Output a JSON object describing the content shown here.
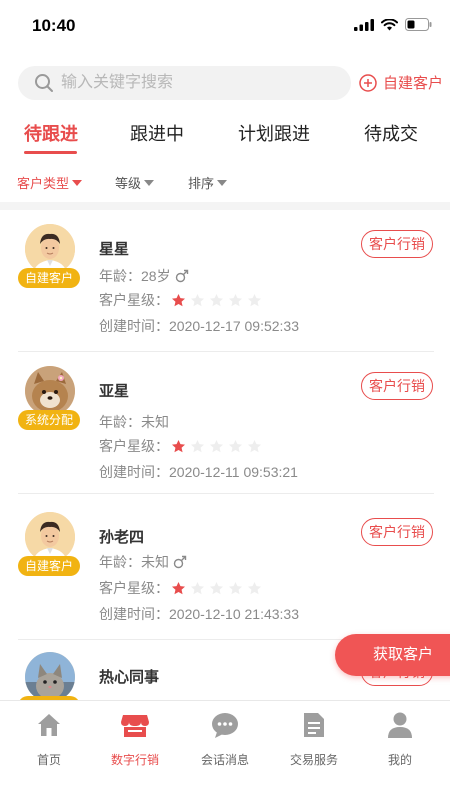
{
  "status_bar": {
    "time": "10:40"
  },
  "search": {
    "placeholder": "输入关键字搜索",
    "add_label": "自建客户"
  },
  "tabs": [
    {
      "label": "待跟进",
      "active": true
    },
    {
      "label": "跟进中",
      "active": false
    },
    {
      "label": "计划跟进",
      "active": false
    },
    {
      "label": "待成交",
      "active": false
    }
  ],
  "filters": [
    {
      "label": "客户类型",
      "active": true
    },
    {
      "label": "等级",
      "active": false
    },
    {
      "label": "排序",
      "active": false
    }
  ],
  "customers": [
    {
      "name": "星星",
      "age_label": "年龄：",
      "age": "28岁",
      "gender_icon": "male-icon",
      "rating_label": "客户星级：",
      "stars": 1,
      "max_stars": 5,
      "created_label": "创建时间：",
      "created": "2020-12-17 09:52:33",
      "badge": "自建客户",
      "avatar": "man-avatar",
      "action": "客户行销"
    },
    {
      "name": "亚星",
      "age_label": "年龄：",
      "age": "未知",
      "gender_icon": "",
      "rating_label": "客户星级：",
      "stars": 1,
      "max_stars": 5,
      "created_label": "创建时间：",
      "created": "2020-12-11 09:53:21",
      "badge": "系统分配",
      "avatar": "dog-avatar",
      "action": "客户行销"
    },
    {
      "name": "孙老四",
      "age_label": "年龄：",
      "age": "未知",
      "gender_icon": "male-icon",
      "rating_label": "客户星级：",
      "stars": 1,
      "max_stars": 5,
      "created_label": "创建时间：",
      "created": "2020-12-10 21:43:33",
      "badge": "自建客户",
      "avatar": "man-avatar",
      "action": "客户行销"
    },
    {
      "name": "热心同事",
      "age_label": "年龄：",
      "age": "",
      "gender_icon": "",
      "rating_label": "",
      "stars": 0,
      "max_stars": 5,
      "created_label": "",
      "created": "",
      "badge": "",
      "avatar": "cat-avatar",
      "action": "客户行销"
    }
  ],
  "fab": {
    "label": "获取客户"
  },
  "bottom_nav": [
    {
      "label": "首页",
      "icon": "home-icon",
      "active": false
    },
    {
      "label": "数字行销",
      "icon": "store-icon",
      "active": true
    },
    {
      "label": "会话消息",
      "icon": "chat-icon",
      "active": false
    },
    {
      "label": "交易服务",
      "icon": "document-icon",
      "active": false
    },
    {
      "label": "我的",
      "icon": "user-icon",
      "active": false
    }
  ],
  "colors": {
    "accent": "#e84d4d",
    "badge": "#f1b312",
    "star_on": "#e84d4d",
    "star_off": "#eeeeee"
  }
}
